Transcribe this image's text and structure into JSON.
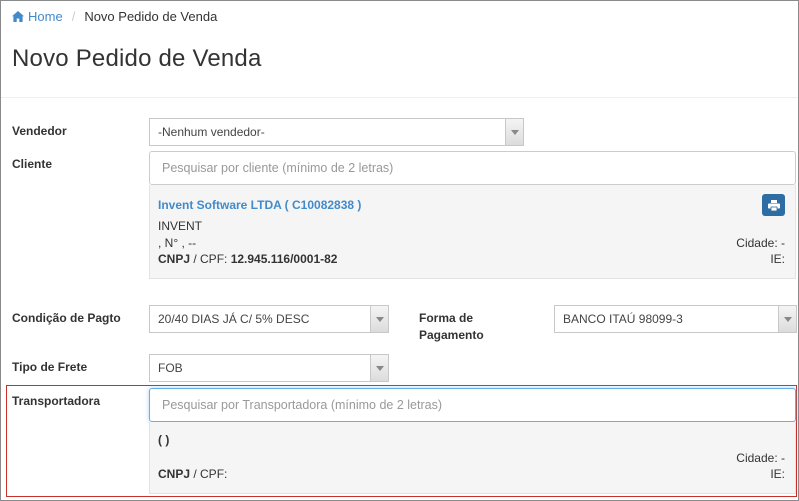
{
  "breadcrumb": {
    "home": "Home",
    "separator": "/",
    "current": "Novo Pedido de Venda"
  },
  "page": {
    "title": "Novo Pedido de Venda"
  },
  "form": {
    "vendedor": {
      "label": "Vendedor",
      "value": "-Nenhum vendedor-"
    },
    "cliente": {
      "label": "Cliente",
      "search_placeholder": "Pesquisar por cliente (mínimo de 2 letras)",
      "selected": {
        "name": "Invent Software LTDA ( C10082838 )",
        "short_name": "INVENT",
        "address": ", N° , --",
        "cnpj_label": "CNPJ",
        "cpf_label": " / CPF: ",
        "cnpj_value": "12.945.116/0001-82",
        "cidade": "Cidade: -",
        "ie": "IE:"
      }
    },
    "condicao_pagto": {
      "label": "Condição de Pagto",
      "value": "20/40 DIAS JÁ C/ 5% DESC"
    },
    "forma_pagamento": {
      "label_line1": "Forma de",
      "label_line2": "Pagamento",
      "value": "BANCO ITAÚ 98099-3"
    },
    "tipo_frete": {
      "label": "Tipo de Frete",
      "value": "FOB"
    },
    "transportadora": {
      "label": "Transportadora",
      "search_placeholder": "Pesquisar por Transportadora (mínimo de 2 letras)",
      "selected": {
        "name": "( )",
        "cnpj_label": "CNPJ",
        "cpf_label": " / CPF:",
        "cidade": "Cidade: -",
        "ie": "IE:"
      }
    }
  },
  "colors": {
    "link": "#428bca",
    "button": "#2e6da4",
    "highlight_border": "#c9302c",
    "panel_bg": "#f5f5f5"
  },
  "icons": [
    "home-icon",
    "print-icon",
    "dropdown-arrow-icon"
  ]
}
